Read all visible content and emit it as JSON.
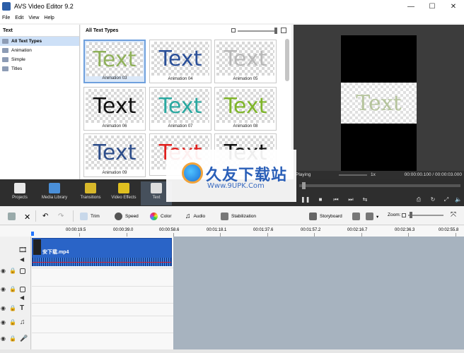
{
  "window": {
    "title": "AVS Video Editor 9.2",
    "minimize": "—",
    "maximize": "☐",
    "close": "✕"
  },
  "menu": [
    "File",
    "Edit",
    "View",
    "Help"
  ],
  "text_panel": {
    "header": "Text",
    "items": [
      {
        "label": "All Text Types",
        "active": true
      },
      {
        "label": "Animation",
        "active": false
      },
      {
        "label": "Simple",
        "active": false
      },
      {
        "label": "Titles",
        "active": false
      }
    ]
  },
  "gallery": {
    "header": "All Text Types",
    "thumb_text": "Text",
    "items": [
      {
        "caption": "Animation 03",
        "color": "#8fb05a"
      },
      {
        "caption": "Animation 04",
        "color": "#2a4f98"
      },
      {
        "caption": "Animation 05",
        "color": "#b8b8b8"
      },
      {
        "caption": "Animation 06",
        "color": "#111111"
      },
      {
        "caption": "Animation 07",
        "color": "#2aa8a0"
      },
      {
        "caption": "Animation 08",
        "color": "#7fb52a"
      },
      {
        "caption": "Animation 09",
        "color": "#2d4d8a"
      },
      {
        "caption": "",
        "color": "#e0201e"
      },
      {
        "caption": "",
        "color": "#111111"
      }
    ]
  },
  "preview": {
    "text": "Text"
  },
  "playback": {
    "status": "Playing",
    "speed": "1x",
    "time": "00:00:00.100 / 00:00:03.000"
  },
  "main_tools": [
    {
      "label": "Projects",
      "color": "#e8e8e8",
      "active": false
    },
    {
      "label": "Media Library",
      "color": "#4a8fd8",
      "active": false
    },
    {
      "label": "Transitions",
      "color": "#d8b82a",
      "active": false
    },
    {
      "label": "Video Effects",
      "color": "#e0c020",
      "active": false
    },
    {
      "label": "Text",
      "color": "#dddddd",
      "active": true
    }
  ],
  "edit_tools": {
    "trim": "Trim",
    "speed": "Speed",
    "color": "Color",
    "audio": "Audio",
    "stabilization": "Stabilization",
    "storyboard": "Storyboard",
    "zoom": "Zoom:"
  },
  "ruler": [
    "00:00:19.5",
    "00:00:39.0",
    "00:00:58.6",
    "00:01:18.1",
    "00:01:37.6",
    "00:01:57.2",
    "00:02:16.7",
    "00:02:36.3",
    "00:02:55.8"
  ],
  "clip": {
    "name": "安下载.mp4"
  },
  "watermark": {
    "title": "久友下载站",
    "url": "Www.9UPK.Com"
  }
}
